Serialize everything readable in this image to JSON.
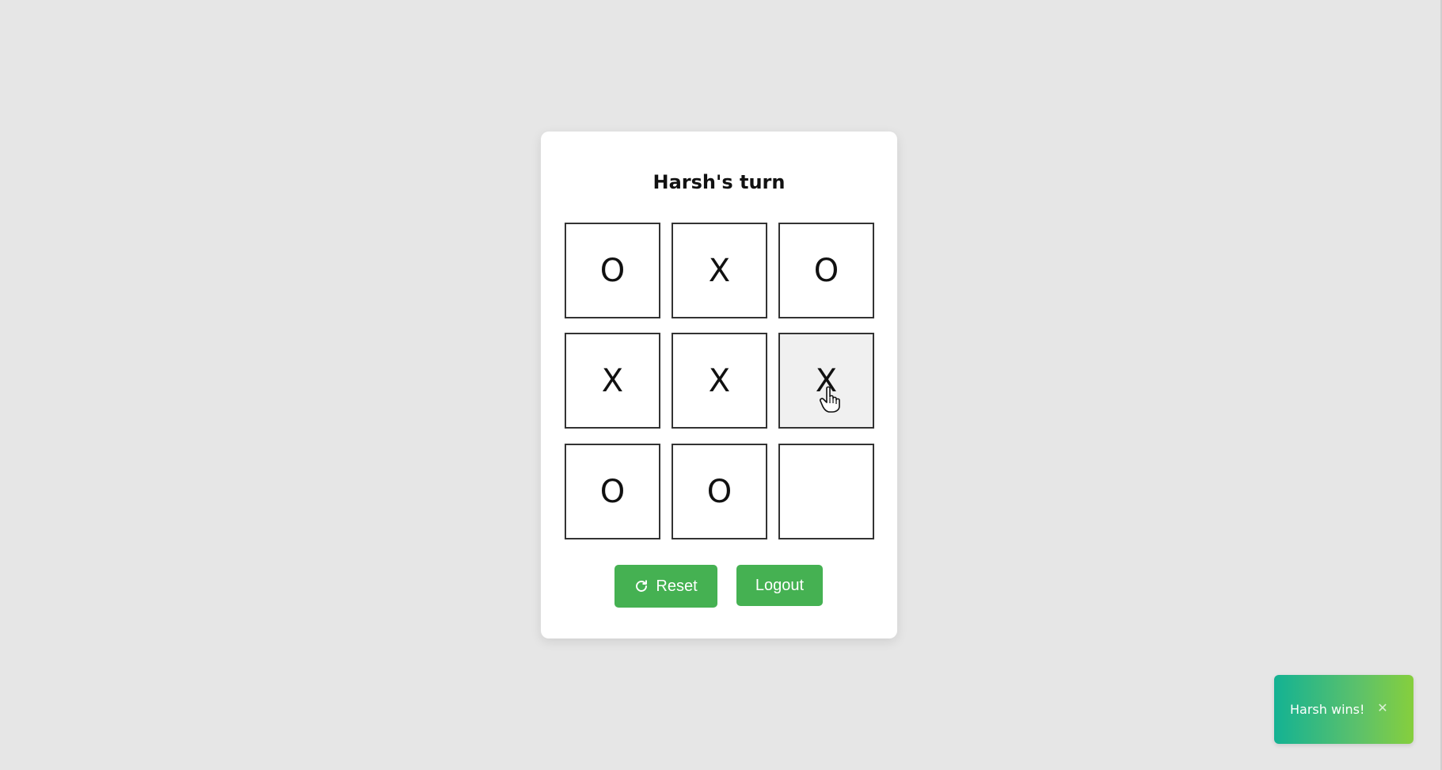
{
  "game": {
    "turn_title": "Harsh's turn",
    "board": [
      "O",
      "X",
      "O",
      "X",
      "X",
      "X",
      "O",
      "O",
      ""
    ],
    "hovered_cell": 5
  },
  "buttons": {
    "reset_label": "Reset",
    "reset_icon": "refresh-icon",
    "logout_label": "Logout"
  },
  "toast": {
    "message": "Harsh wins!",
    "close_glyph": "✕"
  },
  "colors": {
    "background": "#e6e6e6",
    "card": "#ffffff",
    "button": "#45b152",
    "toast_gradient_start": "#13b293",
    "toast_gradient_end": "#86cf3d"
  }
}
